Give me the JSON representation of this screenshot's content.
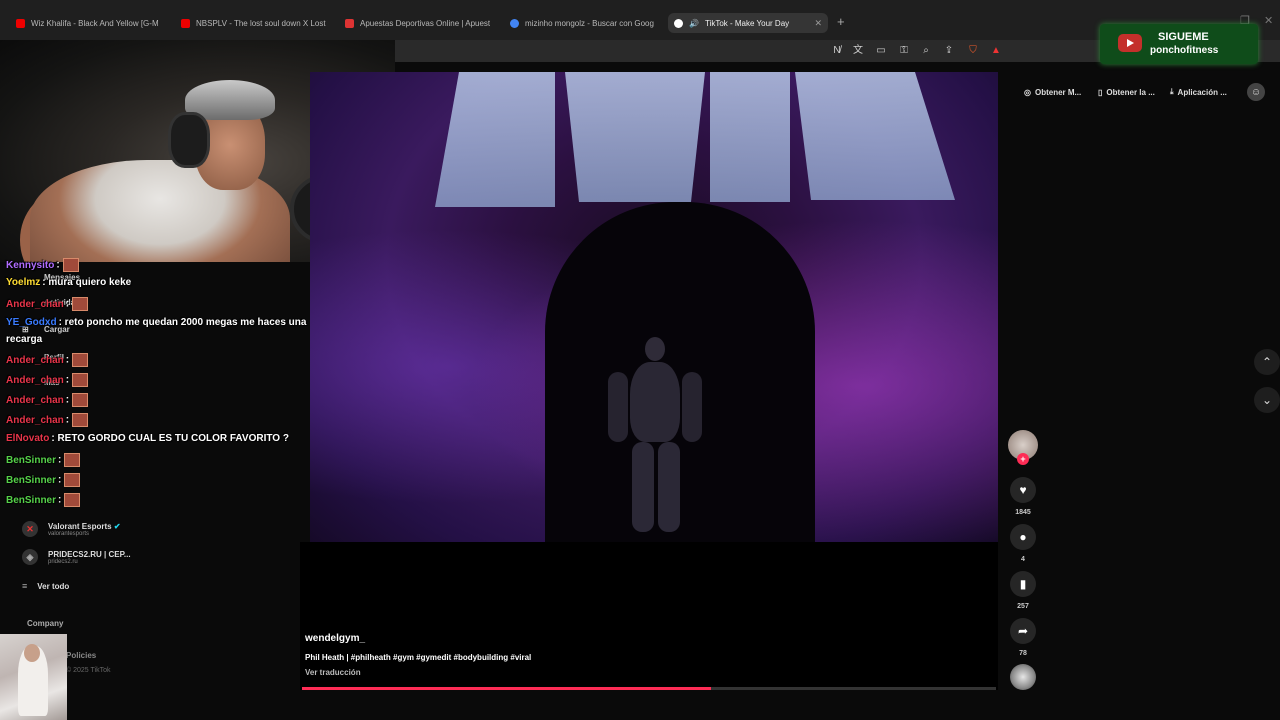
{
  "browser": {
    "tabs": [
      {
        "title": "Wiz Khalifa - Black And Yellow [G-M",
        "favicon_color": "#ff0000"
      },
      {
        "title": "NBSPLV - The lost soul down X Lost",
        "favicon_color": "#ff0000"
      },
      {
        "title": "Apuestas Deportivas Online | Apuest",
        "favicon_color": "#d33"
      },
      {
        "title": "mizinho mongolz - Buscar con Goog",
        "favicon_color": "#4285f4"
      },
      {
        "title": "TikTok - Make Your Day",
        "favicon_color": "#ffffff"
      }
    ],
    "new_tab": "+",
    "toolbar_icons": [
      "no-translate-icon",
      "translate-icon",
      "cast-icon",
      "key-icon",
      "zoom-icon",
      "share-icon",
      "brave-shield-icon",
      "brave-rewards-icon"
    ]
  },
  "banner": {
    "line1": "SIGUEME",
    "line2": "ponchofitness"
  },
  "tiktok": {
    "top_actions": [
      "Obtener M...",
      "Obtener la ...",
      "Aplicación ..."
    ],
    "sidebar": {
      "ghost_labels": [
        "Mensajes",
        "Actividad",
        "Cargar",
        "Perfil",
        "Más"
      ],
      "accounts": [
        {
          "name": "Valorant Esports",
          "handle": "valorantesports",
          "verified": true
        },
        {
          "name": "PRIDECS2.RU | CEP...",
          "handle": "pridecs2.ru",
          "verified": false
        }
      ],
      "see_all": "Ver todo",
      "company": "Company",
      "policies": "Policies",
      "footer": "© 2025 TikTok"
    },
    "video": {
      "author": "wendelgym_",
      "description": "Phil Heath | #philheath #gym #gymedit #bodybuilding #viral",
      "translate": "Ver traducción",
      "progress": 0.59
    },
    "actions": {
      "likes": "1845",
      "comments": "4",
      "saves": "257",
      "shares": "78"
    }
  },
  "chat": [
    {
      "user": "Kennysito",
      "color": "#b06cff",
      "text": ":",
      "emote": true
    },
    {
      "user": "Yoelmz",
      "color": "#ffdd33",
      "text": ": mura quiero keke",
      "emote": false
    },
    {
      "user": "Ander_chan",
      "color": "#e8354a",
      "text": ":",
      "emote": true
    },
    {
      "user": "YE_Godxd",
      "color": "#3a7bff",
      "text": ": reto poncho me quedan 2000 megas me haces una",
      "emote": false
    },
    {
      "user": "",
      "color": "#ffffff",
      "text": "recarga",
      "emote": false
    },
    {
      "user": "Ander_chan",
      "color": "#e8354a",
      "text": ":",
      "emote": true
    },
    {
      "user": "Ander_chan",
      "color": "#e8354a",
      "text": ":",
      "emote": true
    },
    {
      "user": "Ander_chan",
      "color": "#e8354a",
      "text": ":",
      "emote": true
    },
    {
      "user": "Ander_chan",
      "color": "#e8354a",
      "text": ":",
      "emote": true
    },
    {
      "user": "ElNovato",
      "color": "#e8354a",
      "text": ": RETO GORDO CUAL ES TU COLOR FAVORITO ?",
      "emote": false
    },
    {
      "user": "BenSinner",
      "color": "#56d14a",
      "text": ":",
      "emote": true
    },
    {
      "user": "BenSinner",
      "color": "#56d14a",
      "text": ":",
      "emote": true
    },
    {
      "user": "BenSinner",
      "color": "#56d14a",
      "text": ":",
      "emote": true
    }
  ]
}
